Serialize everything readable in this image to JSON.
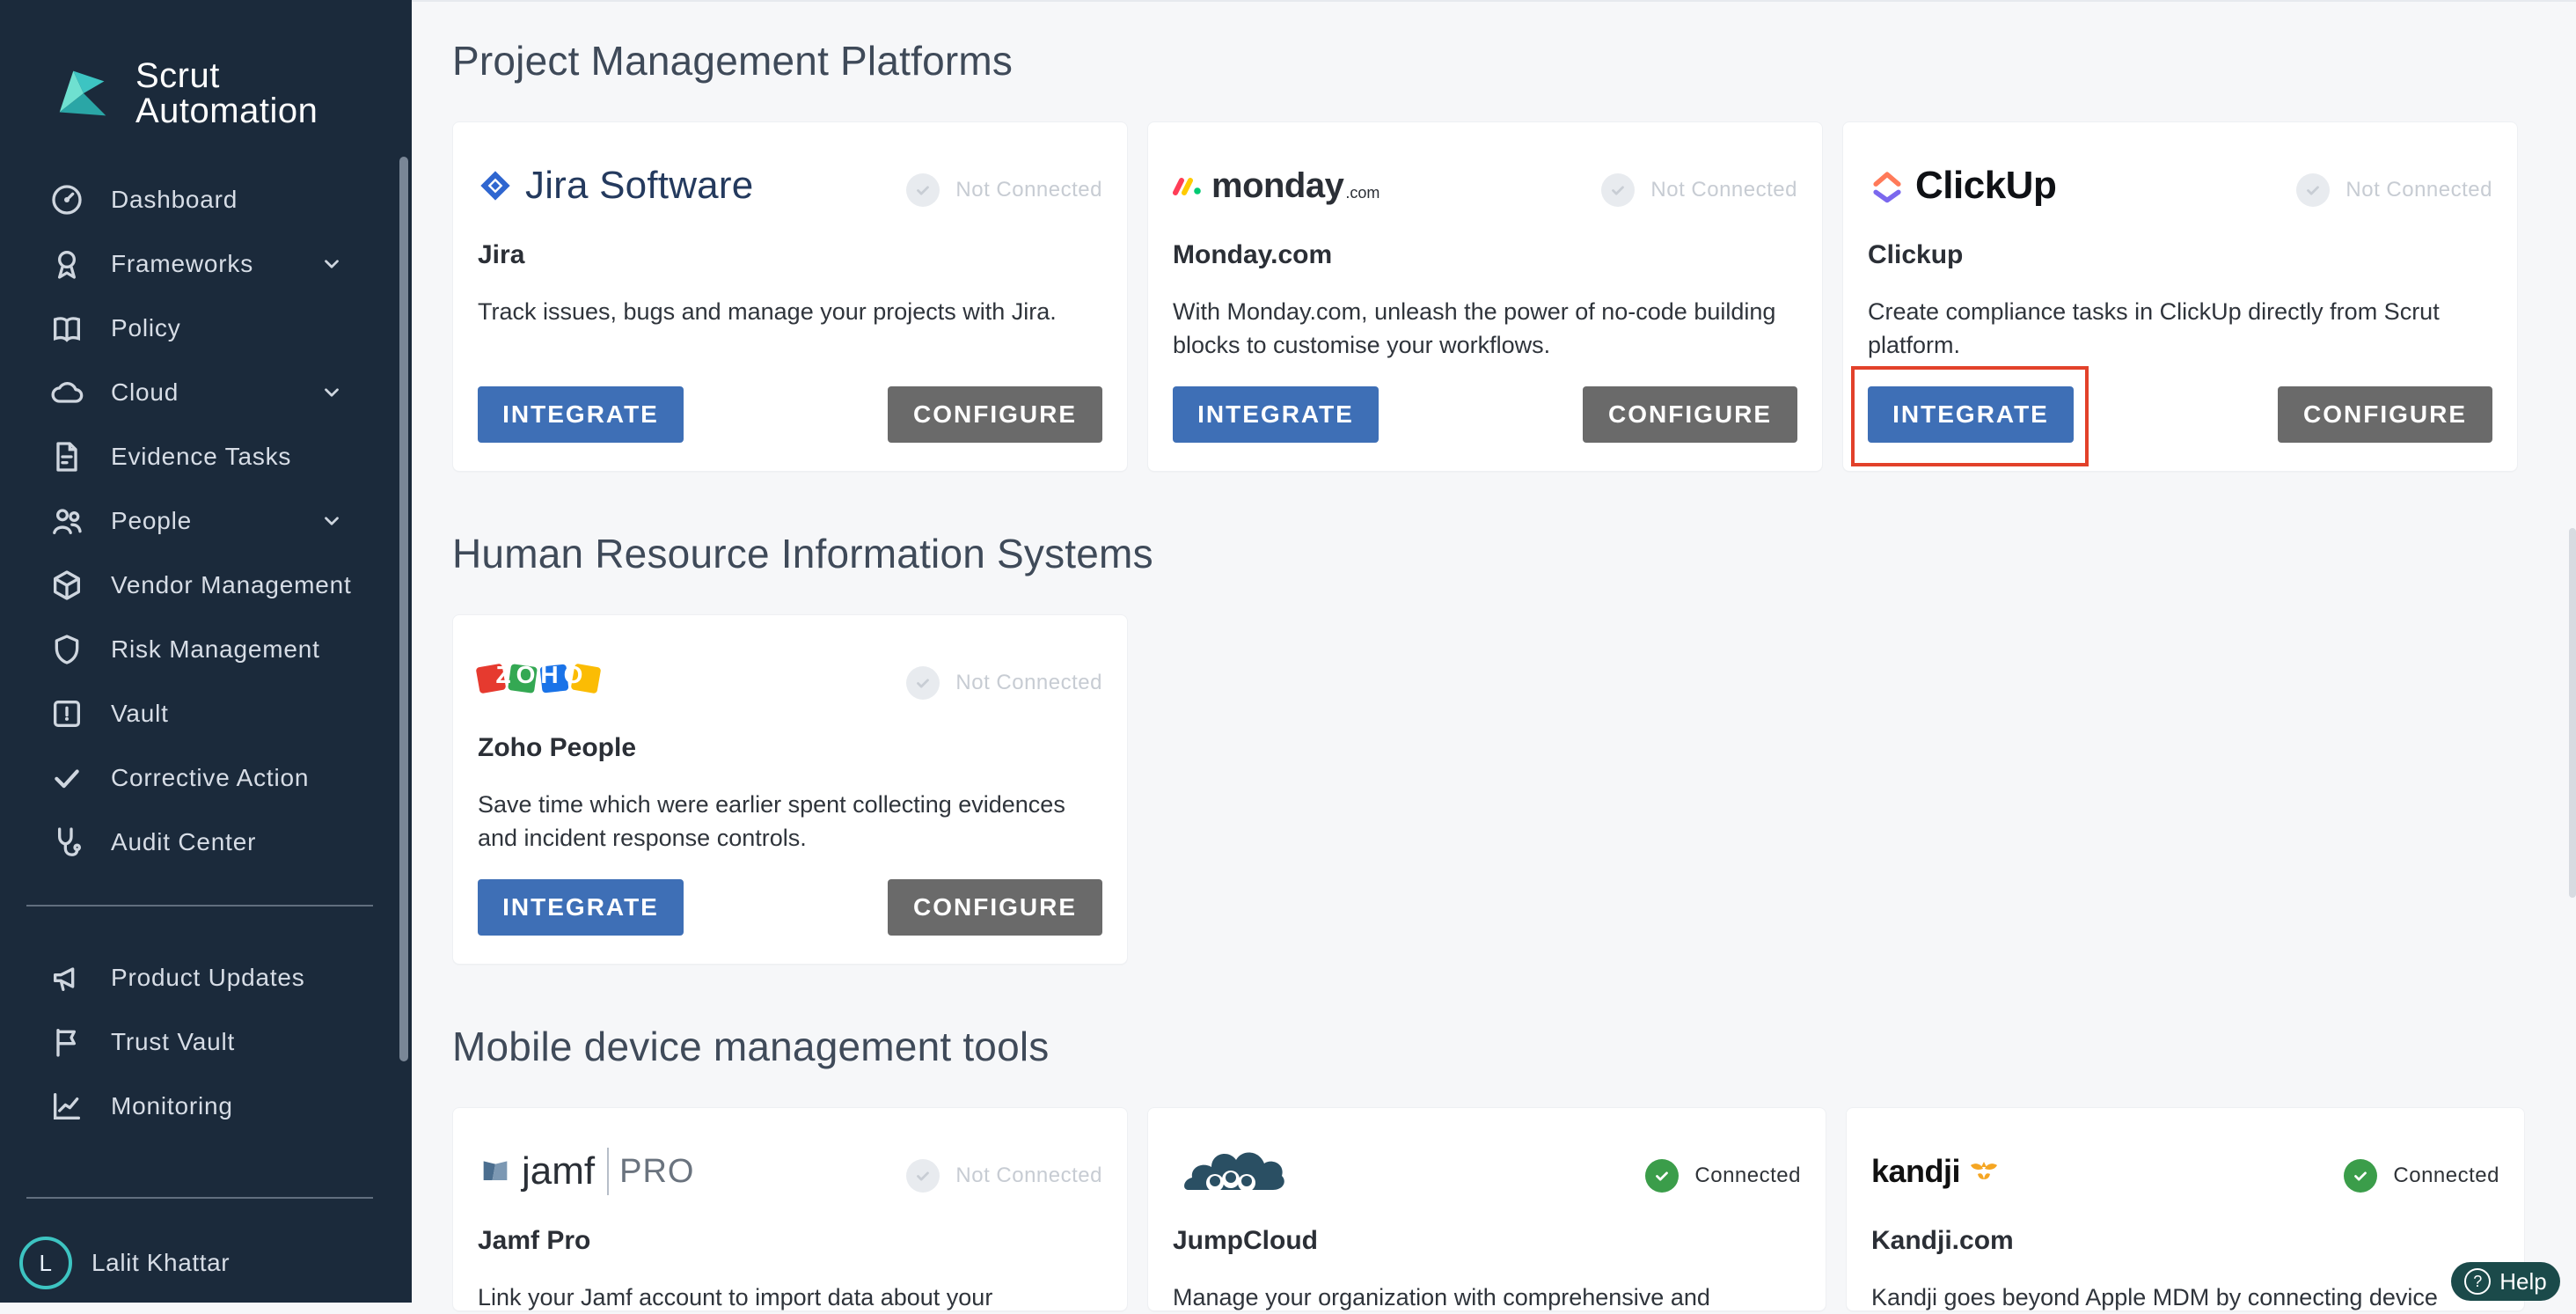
{
  "brand": {
    "line1": "Scrut",
    "line2": "Automation"
  },
  "sidebar": {
    "items": [
      {
        "label": "Dashboard",
        "icon": "dashboard-gauge-icon",
        "chevron": false
      },
      {
        "label": "Frameworks",
        "icon": "award-ribbon-icon",
        "chevron": true
      },
      {
        "label": "Policy",
        "icon": "book-open-icon",
        "chevron": false
      },
      {
        "label": "Cloud",
        "icon": "cloud-icon",
        "chevron": true
      },
      {
        "label": "Evidence Tasks",
        "icon": "document-check-icon",
        "chevron": false
      },
      {
        "label": "People",
        "icon": "people-icon",
        "chevron": true
      },
      {
        "label": "Vendor Management",
        "icon": "cube-icon",
        "chevron": false
      },
      {
        "label": "Risk Management",
        "icon": "shield-icon",
        "chevron": false
      },
      {
        "label": "Vault",
        "icon": "vault-lock-icon",
        "chevron": false
      },
      {
        "label": "Corrective Action",
        "icon": "checkmark-icon",
        "chevron": false
      },
      {
        "label": "Audit Center",
        "icon": "stethoscope-icon",
        "chevron": false
      }
    ],
    "bottom_items": [
      {
        "label": "Product Updates",
        "icon": "megaphone-icon"
      },
      {
        "label": "Trust Vault",
        "icon": "flag-icon"
      },
      {
        "label": "Monitoring",
        "icon": "line-chart-icon"
      }
    ],
    "user": {
      "initial": "L",
      "name": "Lalit Khattar"
    }
  },
  "sections": [
    {
      "title": "Project Management Platforms",
      "cards": [
        {
          "logo_text": "Jira Software",
          "status": "Not Connected",
          "connected": false,
          "name": "Jira",
          "description": "Track issues, bugs and manage your projects with Jira.",
          "integrate_label": "INTEGRATE",
          "configure_label": "CONFIGURE"
        },
        {
          "logo_text": "monday",
          "logo_suffix": ".com",
          "status": "Not Connected",
          "connected": false,
          "name": "Monday.com",
          "description": "With Monday.com, unleash the power of no-code building blocks to customise your workflows.",
          "integrate_label": "INTEGRATE",
          "configure_label": "CONFIGURE"
        },
        {
          "logo_text": "ClickUp",
          "status": "Not Connected",
          "connected": false,
          "name": "Clickup",
          "description": "Create compliance tasks in ClickUp directly from Scrut platform.",
          "integrate_label": "INTEGRATE",
          "configure_label": "CONFIGURE"
        }
      ]
    },
    {
      "title": "Human Resource Information Systems",
      "cards": [
        {
          "logo_text": "ZOHO",
          "status": "Not Connected",
          "connected": false,
          "name": "Zoho People",
          "description": "Save time which were earlier spent collecting evidences and incident response controls.",
          "integrate_label": "INTEGRATE",
          "configure_label": "CONFIGURE"
        }
      ]
    },
    {
      "title": "Mobile device management tools",
      "cards": [
        {
          "logo_text": "jamf",
          "logo_suffix": "PRO",
          "status": "Not Connected",
          "connected": false,
          "name": "Jamf Pro",
          "description": "Link your Jamf account to import data about your"
        },
        {
          "logo_text": "",
          "status": "Connected",
          "connected": true,
          "name": "JumpCloud",
          "description": "Manage your organization with comprehensive and"
        },
        {
          "logo_text": "kandji",
          "status": "Connected",
          "connected": true,
          "name": "Kandji.com",
          "description": "Kandji goes beyond Apple MDM by connecting device"
        }
      ]
    }
  ],
  "help": {
    "label": "Help"
  },
  "colors": {
    "sidebar_bg": "#1b2a3b",
    "integrate_button": "#3e6fb6",
    "configure_button": "#6a6a6a",
    "connected_green": "#3b9d4a",
    "highlight_red": "#e2412a"
  }
}
